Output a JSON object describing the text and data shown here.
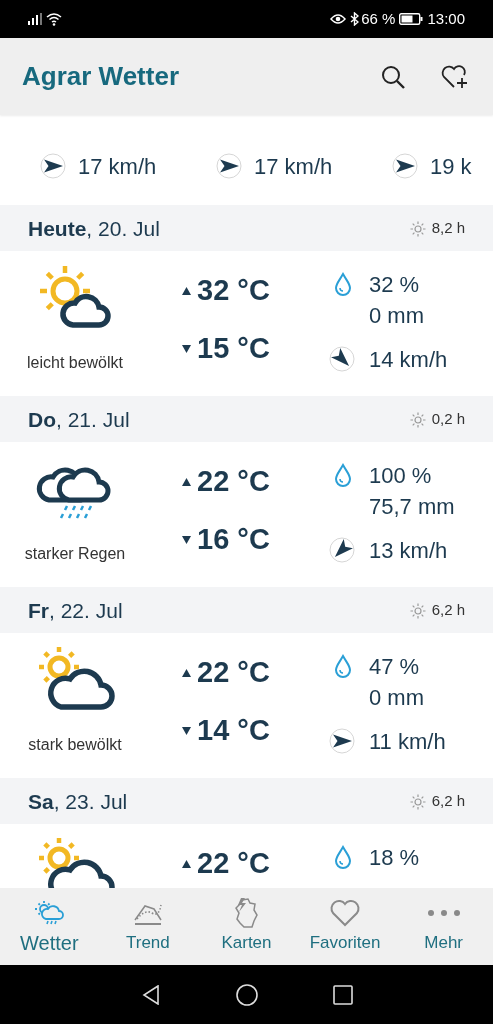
{
  "status_bar": {
    "battery": "66 %",
    "time": "13:00"
  },
  "app_bar": {
    "title": "Agrar Wetter"
  },
  "hourly_strip": [
    {
      "wind": "17 km/h"
    },
    {
      "wind": "17 km/h"
    },
    {
      "wind": "19 k"
    }
  ],
  "days": [
    {
      "date": "**Heute**, 20. Jul",
      "sunshine": "8,2 h",
      "kind": "partly_cloudy",
      "condition": "leicht bewölkt",
      "high": "32 °C",
      "low": "15 °C",
      "rain_chance": "32 %",
      "rain_amount": "0 mm",
      "wind": "14 km/h"
    },
    {
      "date": "**Do**, 21. Jul",
      "sunshine": "0,2 h",
      "kind": "heavy_rain",
      "condition": "starker Regen",
      "high": "22 °C",
      "low": "16 °C",
      "rain_chance": "100 %",
      "rain_amount": "75,7 mm",
      "wind": "13 km/h"
    },
    {
      "date": "**Fr**, 22. Jul",
      "sunshine": "6,2 h",
      "kind": "mostly_cloudy",
      "condition": "stark bewölkt",
      "high": "22 °C",
      "low": "14 °C",
      "rain_chance": "47 %",
      "rain_amount": "0 mm",
      "wind": "11 km/h"
    },
    {
      "date": "**Sa**, 23. Jul",
      "sunshine": "6,2 h",
      "kind": "mostly_cloudy",
      "high": "22 °C",
      "rain_chance": "18 %"
    }
  ],
  "tabs": [
    {
      "label": "Wetter",
      "kind": "weather",
      "selected": true
    },
    {
      "label": "Trend",
      "kind": "trend",
      "selected": false
    },
    {
      "label": "Karten",
      "kind": "map",
      "selected": false
    },
    {
      "label": "Favoriten",
      "kind": "heart",
      "selected": false
    },
    {
      "label": "Mehr",
      "kind": "more",
      "selected": false
    }
  ]
}
